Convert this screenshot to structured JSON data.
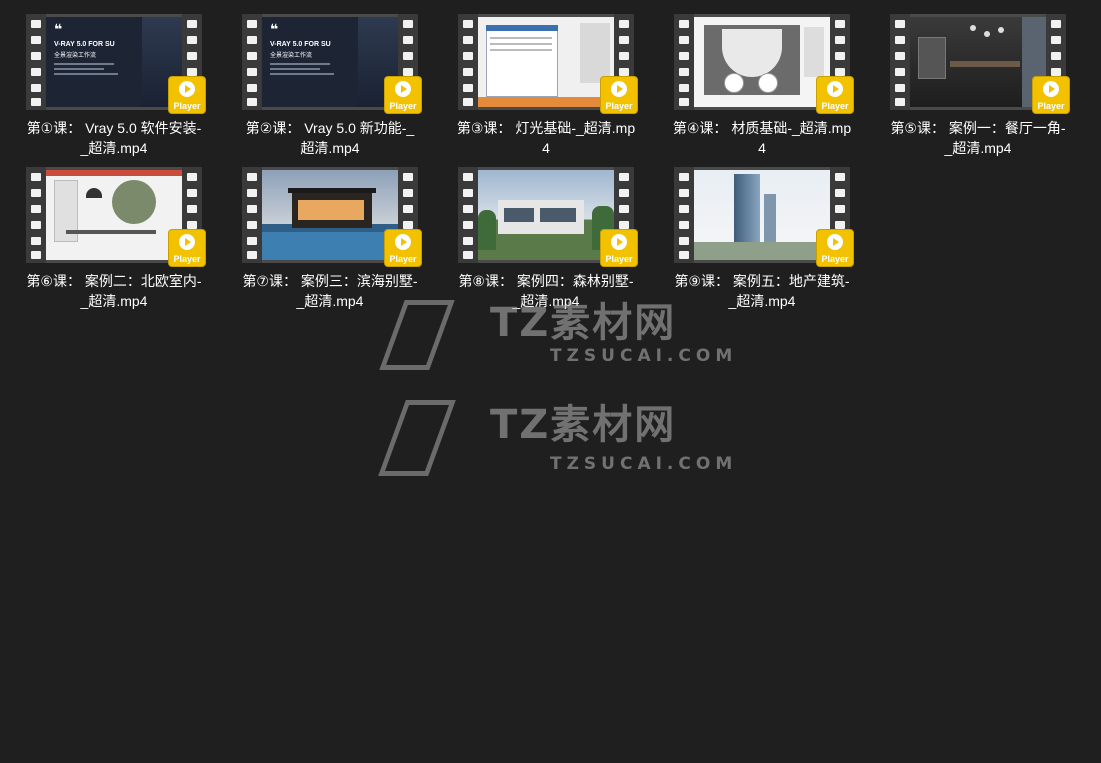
{
  "badge_text": "Player",
  "thumb_text": {
    "slide_line1": "V-RAY 5.0 FOR SU",
    "slide_line2": "全景渲染工作流"
  },
  "files": [
    {
      "label": "第①课： Vray 5.0 软件安装-_超清.mp4",
      "thumb": "slide-dark"
    },
    {
      "label": "第②课： Vray 5.0 新功能-_超清.mp4",
      "thumb": "slide-dark"
    },
    {
      "label": "第③课： 灯光基础-_超清.mp4",
      "thumb": "software-dialog"
    },
    {
      "label": "第④课： 材质基础-_超清.mp4",
      "thumb": "studio-spheres"
    },
    {
      "label": "第⑤课： 案例一：餐厅一角-_超清.mp4",
      "thumb": "dark-dining"
    },
    {
      "label": "第⑥课： 案例二：北欧室内-_超清.mp4",
      "thumb": "nordic-interior"
    },
    {
      "label": "第⑦课： 案例三：滨海别墅-_超清.mp4",
      "thumb": "villa-pool"
    },
    {
      "label": "第⑧课： 案例四：森林别墅-_超清.mp4",
      "thumb": "forest-villa"
    },
    {
      "label": "第⑨课： 案例五：地产建筑-_超清.mp4",
      "thumb": "tower"
    }
  ],
  "watermark": {
    "brand": "TZ素材网",
    "domain": "TZSUCAI.COM"
  },
  "colors": {
    "background": "#1f1f1f",
    "badge": "#f2c200",
    "text": "#ffffff"
  }
}
